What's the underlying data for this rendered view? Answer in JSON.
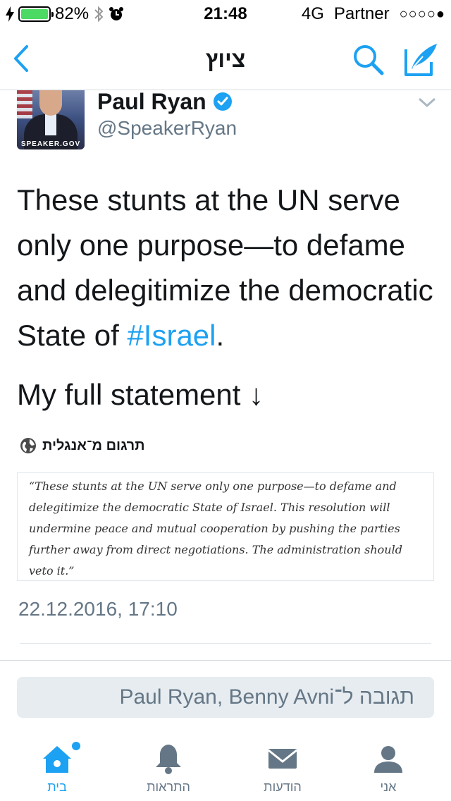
{
  "status_bar": {
    "battery_percent": "82%",
    "time": "21:48",
    "network": "4G",
    "carrier": "Partner",
    "signal": "○○○○●"
  },
  "nav": {
    "title": "ציוץ",
    "icons": [
      "back-icon",
      "search-icon",
      "compose-icon"
    ]
  },
  "tweet": {
    "avatar_tag": "SPEAKER.GOV",
    "display_name": "Paul Ryan",
    "handle": "@SpeakerRyan",
    "text_before_hashtag": "These stunts at the UN serve only one purpose—to defame and delegitimize the democratic State of ",
    "hashtag": "#Israel",
    "text_after_hashtag": ".",
    "text_line2": "My full statement ↓",
    "translate_label": "תרגום מ־אנגלית",
    "statement_image_text": "“These stunts at the UN serve only one purpose—to defame and delegitimize the democratic State of Israel. This resolution will undermine peace and mutual cooperation by pushing the parties further away from direct negotiations. The administration should veto it.”",
    "timestamp": "22.12.2016, 17:10"
  },
  "reply": {
    "placeholder": "תגובה ל־Paul Ryan, Benny Avni"
  },
  "tabs": [
    {
      "label": "בית",
      "icon": "home-icon",
      "active": true
    },
    {
      "label": "התראות",
      "icon": "bell-icon",
      "active": false
    },
    {
      "label": "הודעות",
      "icon": "envelope-icon",
      "active": false
    },
    {
      "label": "אני",
      "icon": "person-icon",
      "active": false
    }
  ],
  "colors": {
    "accent": "#1da1f2",
    "text": "#14171a",
    "secondary": "#657786",
    "battery": "#4cd964"
  }
}
